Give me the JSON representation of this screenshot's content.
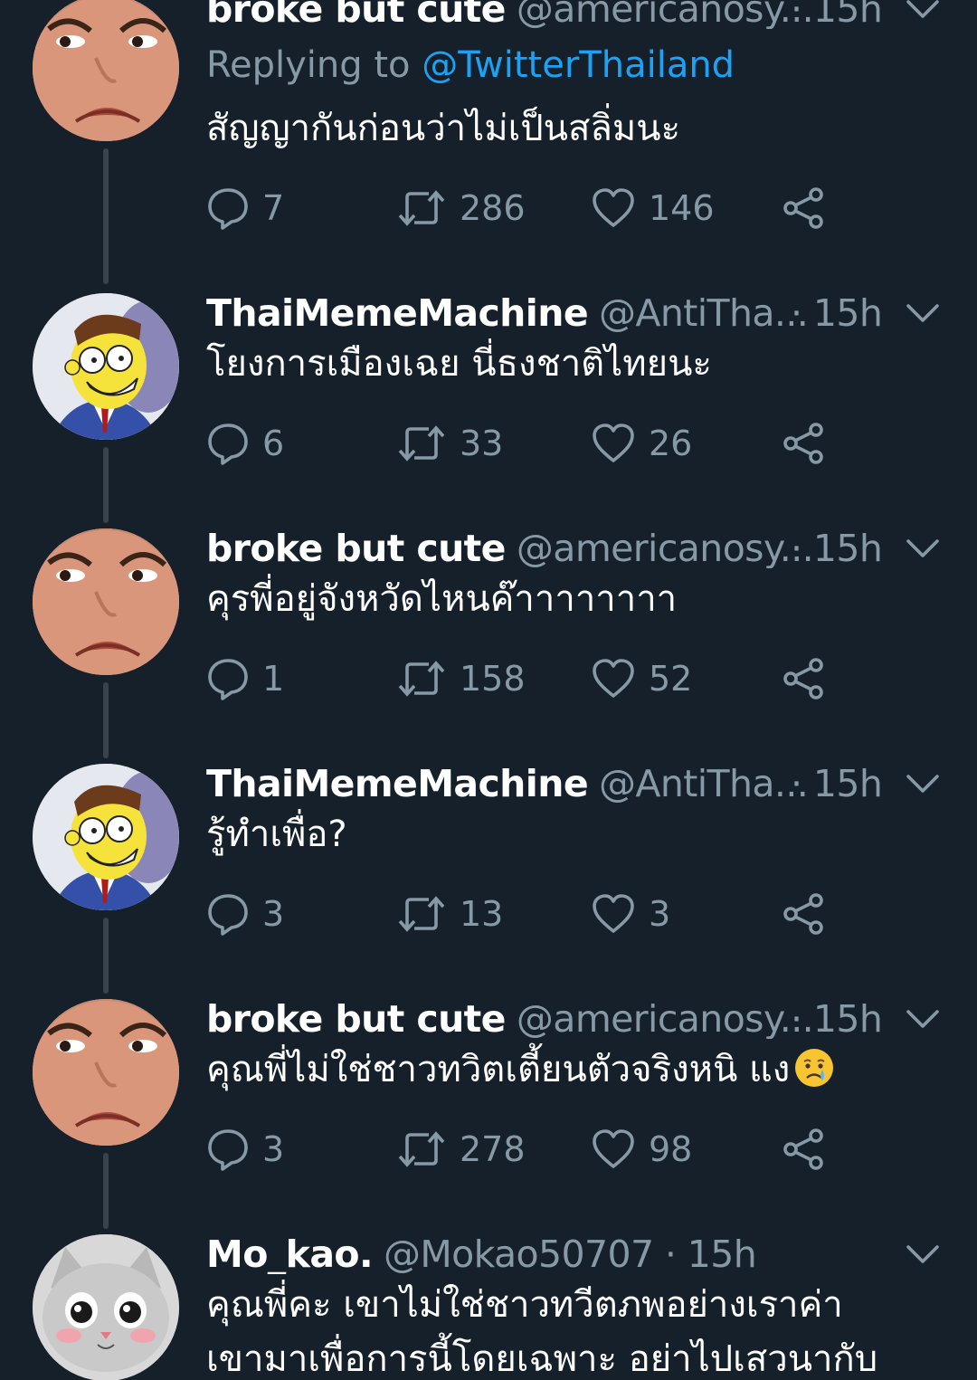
{
  "tweets": [
    {
      "display_name": "broke but cute",
      "handle": "@americanosy...",
      "time": "· 15h",
      "replying_prefix": "Replying to ",
      "replying_mention": "@TwitterThailand",
      "text": "สัญญากันก่อนว่าไม่เป็นสลิ่มนะ",
      "avatar": "girl-face-avatar",
      "replies": "7",
      "retweets": "286",
      "likes": "146"
    },
    {
      "display_name": "ThaiMemeMachine",
      "handle": "@AntiTha...",
      "time": "· 15h",
      "text": "โยงการเมืองเฉย นี่ธงชาติไทยนะ",
      "avatar": "cartoon-man-avatar",
      "replies": "6",
      "retweets": "33",
      "likes": "26"
    },
    {
      "display_name": "broke but cute",
      "handle": "@americanosy...",
      "time": "· 15h",
      "text": "คุรพี่อยู่จังหวัดไหนค๊าาาาาาาา",
      "avatar": "girl-face-avatar",
      "replies": "1",
      "retweets": "158",
      "likes": "52"
    },
    {
      "display_name": "ThaiMemeMachine",
      "handle": "@AntiTha...",
      "time": "· 15h",
      "text": "รู้ทำเพื่อ?",
      "avatar": "cartoon-man-avatar",
      "replies": "3",
      "retweets": "13",
      "likes": "3"
    },
    {
      "display_name": "broke but cute",
      "handle": "@americanosy...",
      "time": "· 15h",
      "text": "คุณพี่ไม่ใช่ชาวทวิตเตี้ยนตัวจริงหนิ แง",
      "emoji": "crying-face-emoji",
      "avatar": "girl-face-avatar",
      "replies": "3",
      "retweets": "278",
      "likes": "98"
    },
    {
      "display_name": "Mo_kao.",
      "handle": "@Mokao50707",
      "time": "· 15h",
      "text_line1": "คุณพี่คะ เขาไม่ใช่ชาวทวีตภพอย่างเราค่า",
      "text_line2": "เขามาเพื่อการนี้โดยเฉพาะ  อย่าไปเสวนากับ",
      "avatar": "cat-avatar"
    }
  ],
  "colors": {
    "background": "#15202b",
    "text": "#ffffff",
    "muted": "#8899a6",
    "link": "#1da1f2",
    "thread_line": "#38444d"
  },
  "icons": {
    "reply": "speech-bubble-icon",
    "retweet": "retweet-arrows-icon",
    "like": "heart-icon",
    "share": "share-nodes-icon",
    "menu": "chevron-down-icon"
  }
}
